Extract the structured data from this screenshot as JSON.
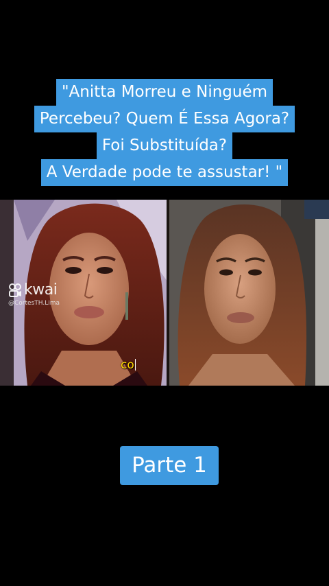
{
  "headline": {
    "lines": [
      "\"Anitta Morreu e Ninguém",
      "Percebeu? Quem É Essa Agora?",
      "Foi Substituída?",
      "A Verdade pode te assustar! \""
    ]
  },
  "watermark": {
    "brand": "kwai",
    "handle": "@CortesTH.Lima"
  },
  "subtitle": {
    "text": "co"
  },
  "badge": {
    "label": "Parte 1"
  },
  "colors": {
    "caption_bg": "#3f9ae0",
    "background": "#000000",
    "subtitle": "#ffd400"
  }
}
